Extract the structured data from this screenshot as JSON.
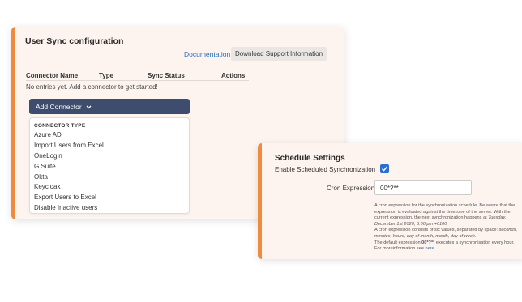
{
  "sync": {
    "title": "User Sync configuration",
    "documentation_link": "Documentation",
    "download_button": "Download Support Information",
    "table_headers": [
      "Connector Name",
      "Type",
      "Sync Status",
      "Actions"
    ],
    "empty_message": "No entries yet. Add a connector to get started!",
    "add_connector_label": "Add Connector",
    "dropdown": {
      "header": "CONNECTOR TYPE",
      "items": [
        "Azure AD",
        "Import Users from Excel",
        "OneLogin",
        "G Suite",
        "Okta",
        "Keycloak",
        "Export Users to Excel",
        "Disable Inactive users"
      ]
    }
  },
  "schedule": {
    "title": "Schedule Settings",
    "enable_label": "Enable Scheduled Synchronization",
    "enabled": true,
    "cron_label": "Cron Expression",
    "cron_value": "00*?**",
    "help": {
      "p1": "A cron expression for the synchronization schedule. Be aware that the expression is evaluated against the timezone of the server. With the current expression, the next synchronization happens at",
      "next_time": "Tuesday, December 1st 2020, 3:00 pm +0100",
      "p2": "A cron expression consists of six values, separated by space:",
      "fields": "seconds, minutes, hours, day of month, month, day of week",
      "p3": "The default expression",
      "default_expr": "00*?**",
      "p4": "executes a synchronisation every hour. For moreinformation see",
      "here_link": "here"
    }
  },
  "colors": {
    "accent": "#f08a3c",
    "panel_bg": "#fdf4ef",
    "primary_button": "#3e4d6d",
    "link": "#2a6fb8",
    "checkbox": "#2a6fcf"
  }
}
